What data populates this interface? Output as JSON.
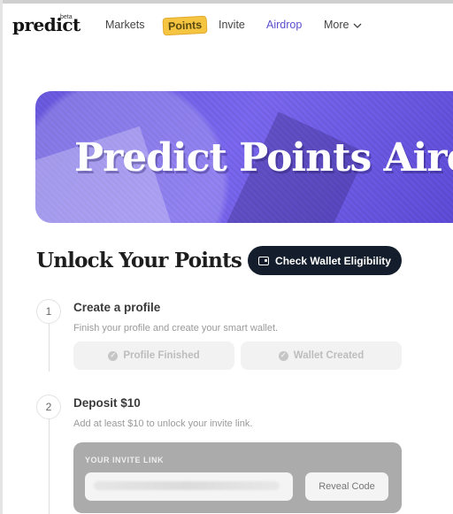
{
  "nav": {
    "logo": "predict",
    "beta": "beta",
    "links": [
      "Markets",
      "Points",
      "Invite",
      "Airdrop",
      "More"
    ]
  },
  "banner": {
    "title": "Predict Points Aird"
  },
  "section": {
    "title": "Unlock Your Points",
    "button": "Check Wallet Eligibility"
  },
  "steps": [
    {
      "number": "1",
      "title": "Create a profile",
      "desc": "Finish your profile and create your smart wallet.",
      "pills": [
        "Profile Finished",
        "Wallet Created"
      ]
    },
    {
      "number": "2",
      "title": "Deposit $10",
      "desc": "Add at least $10 to unlock your invite link.",
      "invite_label": "YOUR INVITE LINK",
      "reveal": "Reveal Code"
    }
  ],
  "colors": {
    "accent": "#6a5ae0",
    "points_badge": "#f5c542",
    "button_dark": "#141d2b"
  }
}
